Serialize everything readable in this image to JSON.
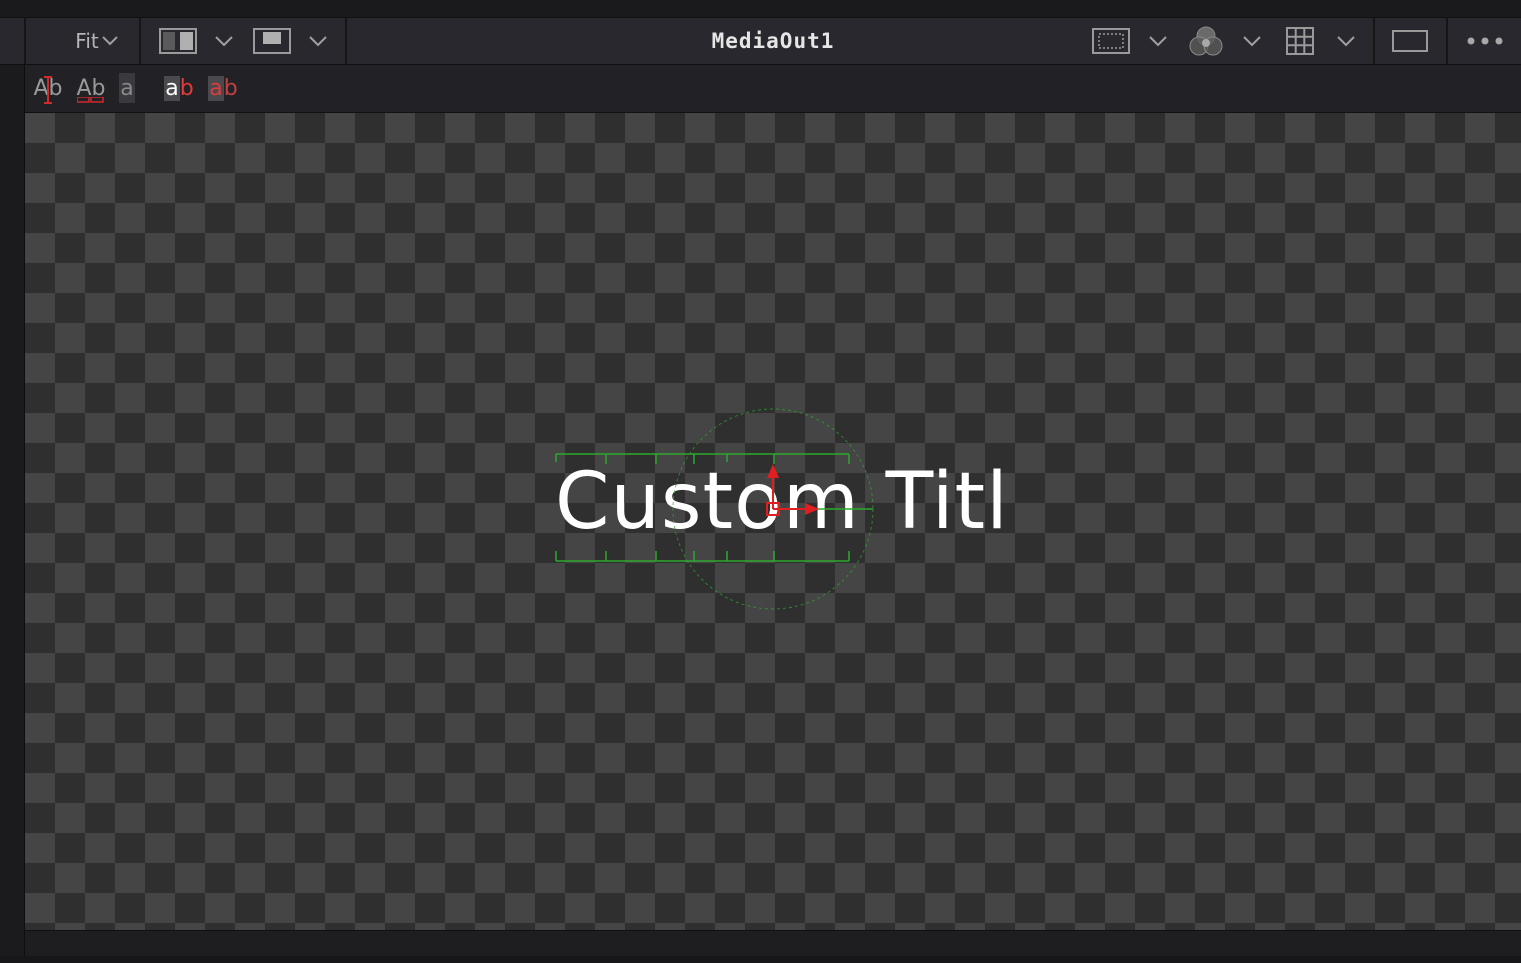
{
  "toolbar": {
    "zoom_label": "Fit",
    "viewer_title": "MediaOut1"
  },
  "text_toolbar": {
    "buttons": [
      {
        "label": "Ab",
        "name": "text-cursor-mode"
      },
      {
        "label": "Ab",
        "name": "text-kerning-mode"
      },
      {
        "label": "a",
        "name": "text-character-mode"
      },
      {
        "label": "ab",
        "name": "text-highlight-selected"
      },
      {
        "label": "ab",
        "name": "text-highlight-all"
      }
    ]
  },
  "viewer": {
    "text_content": "Custom Titl"
  },
  "colors": {
    "accent_red": "#e02020",
    "guide_green": "#2ea82e"
  },
  "icons": [
    "chevron-down-icon",
    "split-view-icon",
    "single-view-icon",
    "roi-icon",
    "color-channels-icon",
    "grid-icon",
    "aspect-rect-icon",
    "more-options-icon"
  ]
}
